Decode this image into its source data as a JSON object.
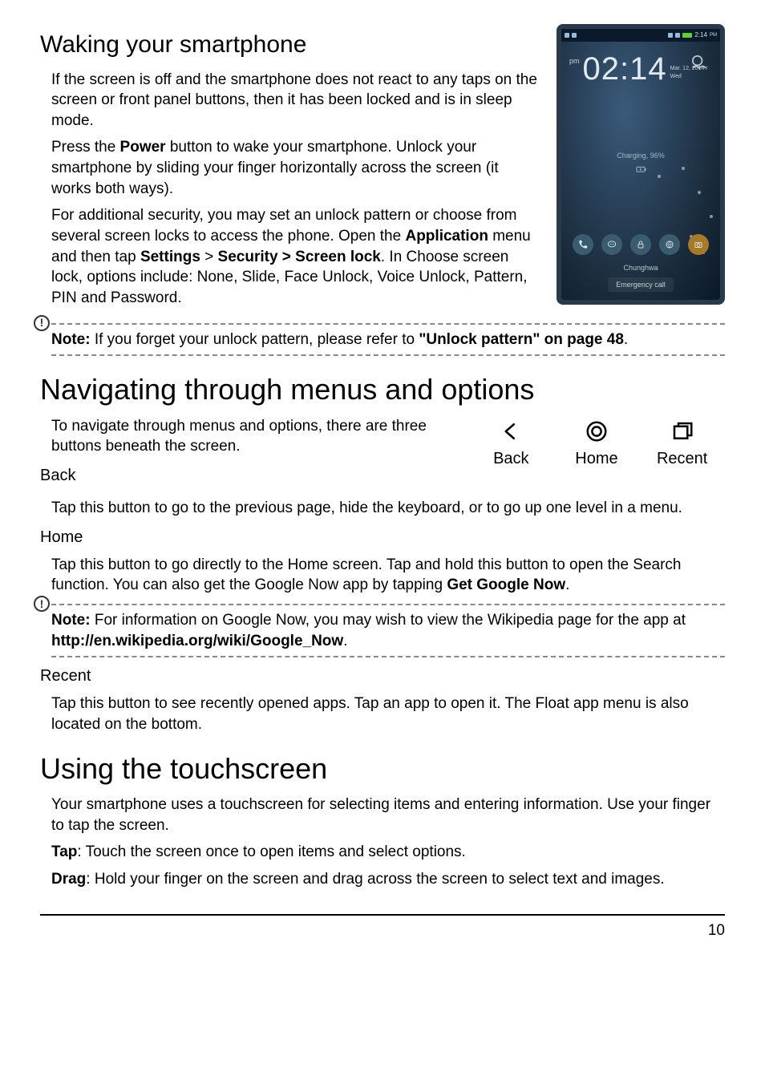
{
  "page_number": "10",
  "sections": {
    "waking": {
      "heading": "Waking your smartphone",
      "p1": "If the screen is off and the smartphone does not react to any taps on the screen or front panel buttons, then it has been locked and is in sleep mode.",
      "p2_a": "Press the ",
      "p2_power": "Power",
      "p2_b": " button to wake your smartphone. Unlock your smartphone by sliding your finger horizontally across the screen (it works both ways).",
      "p3_a": "For additional security, you may set an unlock pattern or choose from several screen locks to access the phone. Open the ",
      "p3_app": "Application",
      "p3_b": " menu and then tap ",
      "p3_settings": "Settings",
      "p3_c": " > ",
      "p3_sec": "Security > Screen lock",
      "p3_d": ". In Choose screen lock, options include: None, Slide, Face Unlock, Voice Unlock, Pattern, PIN and Password."
    },
    "note1": {
      "prefix": "Note:",
      "a": " If you forget your unlock pattern, please refer to ",
      "link": "\"Unlock pattern\" on page 48",
      "b": "."
    },
    "nav": {
      "heading": "Navigating through menus and options",
      "intro": "To navigate through menus and options, there are three buttons beneath the screen.",
      "back_label": "Back",
      "home_label": "Home",
      "recent_label": "Recent",
      "back_h": "Back",
      "back_p": "Tap this button to go to the previous page, hide the keyboard, or to go up one level in a menu.",
      "home_h": "Home",
      "home_p_a": "Tap this button to go directly to the Home screen. Tap and hold this button to open the Search function. You can also get the Google Now app by tapping ",
      "home_p_b": "Get Google Now",
      "home_p_c": ".",
      "recent_h": "Recent",
      "recent_p": "Tap this button to see recently opened apps. Tap an app to open it. The Float app menu is also located on the bottom."
    },
    "note2": {
      "prefix": "Note:",
      "a": " For information on Google Now, you may wish to view the Wikipedia page for the app at ",
      "link": "http://en.wikipedia.org/wiki/Google_Now",
      "b": "."
    },
    "touch": {
      "heading": "Using the touchscreen",
      "p1": "Your smartphone uses a touchscreen for selecting items and entering information. Use your finger to tap the screen.",
      "tap_b": "Tap",
      "tap_t": ": Touch the screen once to open items and select options.",
      "drag_b": "Drag",
      "drag_t": ": Hold your finger on the screen and drag across the screen to select text and images."
    }
  },
  "phone": {
    "status_time": "2:14",
    "status_pm": "PM",
    "clock_time": "02:14",
    "clock_pm": "pm",
    "clock_date": "Mar. 12, 2014 / Wed",
    "charging": "Charging, 96%",
    "carrier": "Chunghwa",
    "emergency": "Emergency call"
  }
}
